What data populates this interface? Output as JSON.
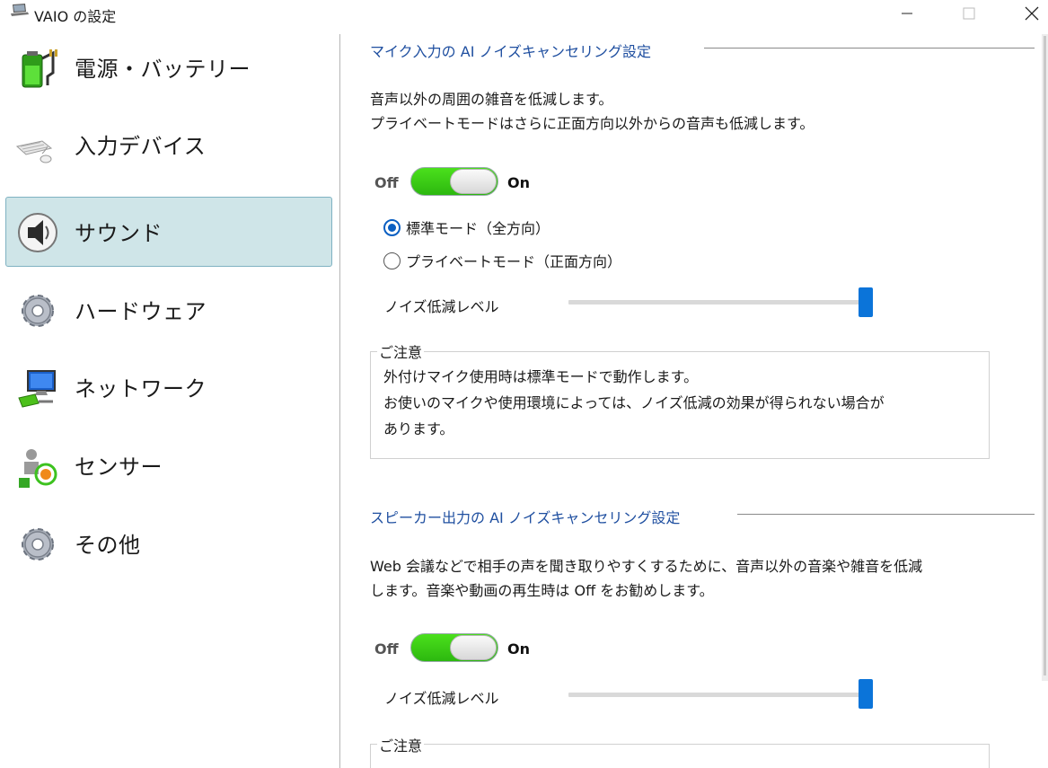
{
  "window": {
    "title": "VAIO の設定",
    "controls": {
      "minimize": "minimize",
      "maximize": "maximize",
      "close": "close"
    }
  },
  "sidebar": {
    "items": [
      {
        "label": "電源・バッテリー",
        "icon": "battery-icon",
        "selected": false
      },
      {
        "label": "入力デバイス",
        "icon": "keyboard-mouse-icon",
        "selected": false
      },
      {
        "label": "サウンド",
        "icon": "speaker-icon",
        "selected": true
      },
      {
        "label": "ハードウェア",
        "icon": "gear-icon",
        "selected": false
      },
      {
        "label": "ネットワーク",
        "icon": "network-icon",
        "selected": false
      },
      {
        "label": "センサー",
        "icon": "sensor-icon",
        "selected": false
      },
      {
        "label": "その他",
        "icon": "gear-icon",
        "selected": false
      }
    ]
  },
  "mic_section": {
    "title": "マイク入力の AI ノイズキャンセリング設定",
    "description_line1": "音声以外の周囲の雑音を低減します。",
    "description_line2": "プライベートモードはさらに正面方向以外からの音声も低減します。",
    "toggle_off_label": "Off",
    "toggle_on_label": "On",
    "toggle_state": "on",
    "radio_standard": "標準モード（全方向）",
    "radio_private": "プライベートモード（正面方向）",
    "selected_mode": "standard",
    "slider_label": "ノイズ低減レベル",
    "slider_value": 1.0,
    "note_title": "ご注意",
    "note_line1": "外付けマイク使用時は標準モードで動作します。",
    "note_line2": "お使いのマイクや使用環境によっては、ノイズ低減の効果が得られない場合が",
    "note_line3": "あります。"
  },
  "speaker_section": {
    "title": "スピーカー出力の AI ノイズキャンセリング設定",
    "description_line1": "Web 会議などで相手の声を聞き取りやすくするために、音声以外の音楽や雑音を低減",
    "description_line2": "します。音楽や動画の再生時は Off をお勧めします。",
    "toggle_off_label": "Off",
    "toggle_on_label": "On",
    "toggle_state": "on",
    "slider_label": "ノイズ低減レベル",
    "slider_value": 1.0,
    "note_title": "ご注意"
  },
  "colors": {
    "accent": "#0b74d9",
    "section_title": "#1f4fa0",
    "toggle_on": "#2cb80f",
    "sidebar_selected": "#cfe5e8"
  }
}
